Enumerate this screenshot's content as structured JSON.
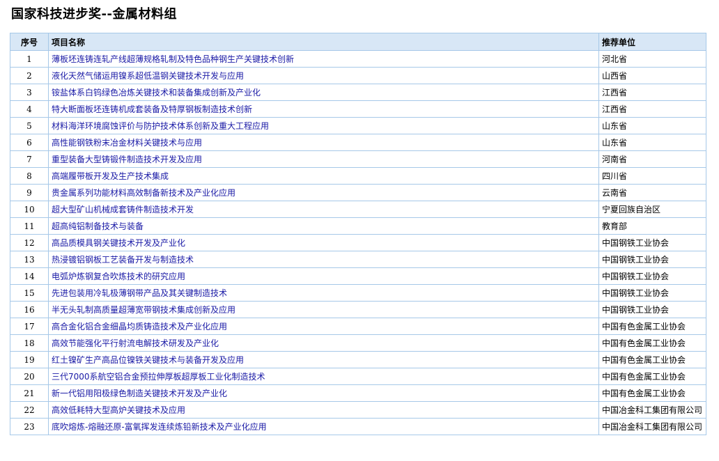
{
  "page": {
    "title": "国家科技进步奖--金属材料组"
  },
  "table": {
    "headers": {
      "no": "序号",
      "name": "项目名称",
      "org": "推荐单位"
    },
    "rows": [
      {
        "no": "1",
        "name": "薄板坯连铸连轧产线超薄规格轧制及特色品种钢生产关键技术创新",
        "org": "河北省"
      },
      {
        "no": "2",
        "name": "液化天然气储运用镍系超低温钢关键技术开发与应用",
        "org": "山西省"
      },
      {
        "no": "3",
        "name": "铵盐体系白钨绿色冶炼关键技术和装备集成创新及产业化",
        "org": "江西省"
      },
      {
        "no": "4",
        "name": "特大断面板坯连铸机成套装备及特厚钢板制造技术创新",
        "org": "江西省"
      },
      {
        "no": "5",
        "name": "材料海洋环境腐蚀评价与防护技术体系创新及重大工程应用",
        "org": "山东省"
      },
      {
        "no": "6",
        "name": "高性能钢铁粉末冶金材料关键技术与应用",
        "org": "山东省"
      },
      {
        "no": "7",
        "name": "重型装备大型铸锻件制造技术开发及应用",
        "org": "河南省"
      },
      {
        "no": "8",
        "name": "高端履带板开发及生产技术集成",
        "org": "四川省"
      },
      {
        "no": "9",
        "name": "贵金属系列功能材料高效制备新技术及产业化应用",
        "org": "云南省"
      },
      {
        "no": "10",
        "name": "超大型矿山机械成套铸件制造技术开发",
        "org": "宁夏回族自治区"
      },
      {
        "no": "11",
        "name": "超高纯铝制备技术与装备",
        "org": "教育部"
      },
      {
        "no": "12",
        "name": "高品质模具钢关键技术开发及产业化",
        "org": "中国钢铁工业协会"
      },
      {
        "no": "13",
        "name": "热浸镀铝钢板工艺装备开发与制造技术",
        "org": "中国钢铁工业协会"
      },
      {
        "no": "14",
        "name": "电弧炉炼钢复合吹炼技术的研究应用",
        "org": "中国钢铁工业协会"
      },
      {
        "no": "15",
        "name": "先进包装用冷轧极薄钢带产品及其关键制造技术",
        "org": "中国钢铁工业协会"
      },
      {
        "no": "16",
        "name": "半无头轧制高质量超薄宽带钢技术集成创新及应用",
        "org": "中国钢铁工业协会"
      },
      {
        "no": "17",
        "name": "高合金化铝合金细晶均质铸造技术及产业化应用",
        "org": "中国有色金属工业协会"
      },
      {
        "no": "18",
        "name": "高效节能强化平行射流电解技术研发及产业化",
        "org": "中国有色金属工业协会"
      },
      {
        "no": "19",
        "name": "红土镍矿生产高品位镍铁关键技术与装备开发及应用",
        "org": "中国有色金属工业协会"
      },
      {
        "no": "20",
        "name": "三代7000系航空铝合金预拉伸厚板超厚板工业化制造技术",
        "org": "中国有色金属工业协会"
      },
      {
        "no": "21",
        "name": "新一代铝用阳极绿色制造关键技术开发及产业化",
        "org": "中国有色金属工业协会"
      },
      {
        "no": "22",
        "name": "高效低耗特大型高炉关键技术及应用",
        "org": "中国冶金科工集团有限公司"
      },
      {
        "no": "23",
        "name": "底吹熔炼-熔融还原-富氧挥发连续炼铅新技术及产业化应用",
        "org": "中国冶金科工集团有限公司"
      }
    ]
  }
}
